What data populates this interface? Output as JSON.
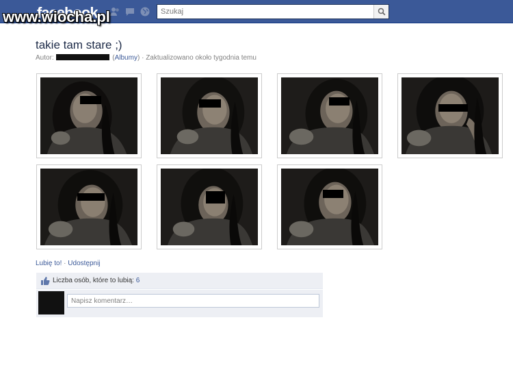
{
  "topbar": {
    "logo": "facebook",
    "watermark": "www.wiocha.pl",
    "search_placeholder": "Szukaj",
    "brand_color": "#3b5998"
  },
  "album": {
    "title": "takie tam stare ;)",
    "author_label": "Autor:",
    "albums_link": "Albumy",
    "updated": "Zaktualizowano około tygodnia temu"
  },
  "photos": [
    {
      "icon": "photo-thumbnail"
    },
    {
      "icon": "photo-thumbnail"
    },
    {
      "icon": "photo-thumbnail"
    },
    {
      "icon": "photo-thumbnail"
    },
    {
      "icon": "photo-thumbnail"
    },
    {
      "icon": "photo-thumbnail"
    },
    {
      "icon": "photo-thumbnail"
    }
  ],
  "actions": {
    "like": "Lubię to!",
    "separator": "·",
    "share": "Udostępnij"
  },
  "likes": {
    "label": "Liczba osób, które to lubią:",
    "count": "6"
  },
  "comment": {
    "placeholder": "Napisz komentarz…"
  }
}
